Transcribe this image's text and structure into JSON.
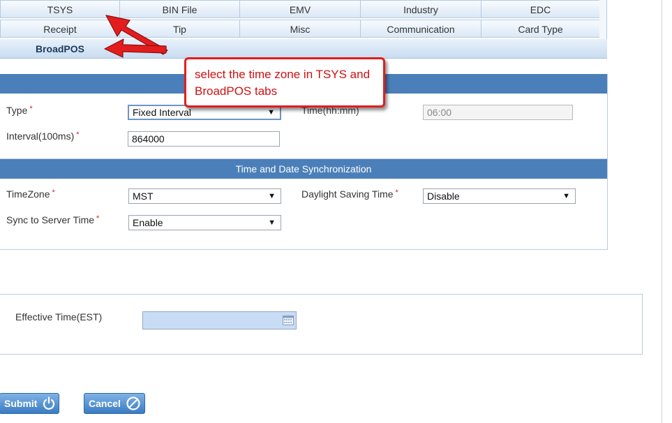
{
  "tabs_row1": [
    "TSYS",
    "BIN File",
    "EMV",
    "Industry",
    "EDC"
  ],
  "tabs_row2": [
    "Receipt",
    "Tip",
    "Misc",
    "Communication",
    "Card Type"
  ],
  "tab_active": "BroadPOS",
  "upper_section": {
    "type_label": "Type",
    "type_value": "Fixed Interval",
    "time_label": "Time(hh:mm)",
    "time_value": "06:00",
    "interval_label": "Interval(100ms)",
    "interval_value": "864000"
  },
  "time_sync": {
    "header": "Time and Date Synchronization",
    "timezone_label": "TimeZone",
    "timezone_value": "MST",
    "dst_label": "Daylight Saving Time",
    "dst_value": "Disable",
    "sync_label": "Sync to Server Time",
    "sync_value": "Enable"
  },
  "effective": {
    "label": "Effective Time(EST)",
    "value": ""
  },
  "buttons": {
    "submit": "Submit",
    "cancel": "Cancel"
  },
  "required_mark": "*",
  "annotation": {
    "text": "select the time zone in TSYS and BroadPOS tabs"
  },
  "colors": {
    "section_bar": "#4b7fb9",
    "annotation": "#e31d1d",
    "button": "#3a7cc2"
  }
}
